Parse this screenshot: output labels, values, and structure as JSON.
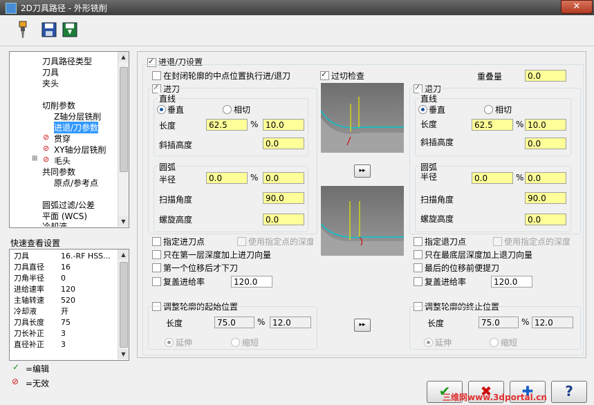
{
  "window": {
    "title": "2D刀具路径 - 外形铣削",
    "close": "✕"
  },
  "toolbar": {
    "icons": [
      "tool-icon",
      "save-icon",
      "save-as-icon"
    ]
  },
  "tree": {
    "items": [
      "刀具路径类型",
      "刀具",
      "夹头",
      "",
      "切削参数",
      "Z轴分层铣削",
      "进退/刀参数",
      "贯穿",
      "XY轴分层铣削",
      "毛头",
      "共同参数",
      "原点/参考点",
      "",
      "圆弧过滤/公差",
      "平面 (WCS)",
      "冷却液"
    ]
  },
  "quick": {
    "title": "快速查看设置",
    "rows": [
      {
        "k": "刀具",
        "v": "16.-RF HSS..."
      },
      {
        "k": "刀具直径",
        "v": "16"
      },
      {
        "k": "刀角半径",
        "v": "0"
      },
      {
        "k": "进给速率",
        "v": "120"
      },
      {
        "k": "主轴转速",
        "v": "520"
      },
      {
        "k": "冷却液",
        "v": "开"
      },
      {
        "k": "刀具长度",
        "v": "75"
      },
      {
        "k": "刀长补正",
        "v": "3"
      },
      {
        "k": "直径补正",
        "v": "3"
      }
    ]
  },
  "legend": {
    "edit": "=编辑",
    "disabled": "=无效"
  },
  "main": {
    "enable": "进退/刀设置",
    "midpoint": "在封闭轮廓的中点位置执行进/退刀",
    "gouge": "过切检查",
    "overlap_label": "重叠量",
    "overlap": "0.0",
    "entry": {
      "title": "进刀",
      "line": "直线",
      "perp": "垂直",
      "tangent": "相切",
      "length_label": "长度",
      "length_pct": "62.5",
      "length_val": "10.0",
      "pct": "%",
      "ramp_label": "斜插高度",
      "ramp": "0.0",
      "arc": "圆弧",
      "radius_label": "半径",
      "radius_pct": "0.0",
      "radius_val": "0.0",
      "sweep_label": "扫描角度",
      "sweep": "90.0",
      "helix_label": "螺旋高度",
      "helix": "0.0",
      "point": "指定进刀点",
      "use_depth": "使用指定点的深度",
      "first_depth": "只在第一层深度加上进刀向量",
      "first_move": "第一个位移后才下刀",
      "override": "复盖进给率",
      "feed": "120.0"
    },
    "exit": {
      "title": "退刀",
      "line": "直线",
      "perp": "垂直",
      "tangent": "相切",
      "length_label": "长度",
      "length_pct": "62.5",
      "length_val": "10.0",
      "pct": "%",
      "ramp_label": "斜插高度",
      "ramp": "0.0",
      "arc": "圆弧",
      "radius_label": "半径",
      "radius_pct": "0.0",
      "radius_val": "0.0",
      "sweep_label": "扫描角度",
      "sweep": "90.0",
      "helix_label": "螺旋高度",
      "helix": "0.0",
      "point": "指定退刀点",
      "use_depth": "使用指定点的深度",
      "last_depth": "只在最底层深度加上退刀向量",
      "last_move": "最后的位移前便提刀",
      "override": "复盖进给率",
      "feed": "120.0"
    },
    "start_adj": {
      "title": "调整轮廓的起始位置",
      "length_label": "长度",
      "pct_val": "75.0",
      "pct": "%",
      "val": "12.0",
      "extend": "延伸",
      "shorten": "缩短"
    },
    "end_adj": {
      "title": "调整轮廓的终止位置",
      "length_label": "长度",
      "pct_val": "75.0",
      "pct": "%",
      "val": "12.0",
      "extend": "延伸",
      "shorten": "缩短"
    },
    "copy_btn": "▸▸"
  },
  "buttons": {
    "ok": "✔",
    "cancel": "✖",
    "add": "✚",
    "help": "?"
  },
  "watermark": "三维网www.3dportal.cn"
}
